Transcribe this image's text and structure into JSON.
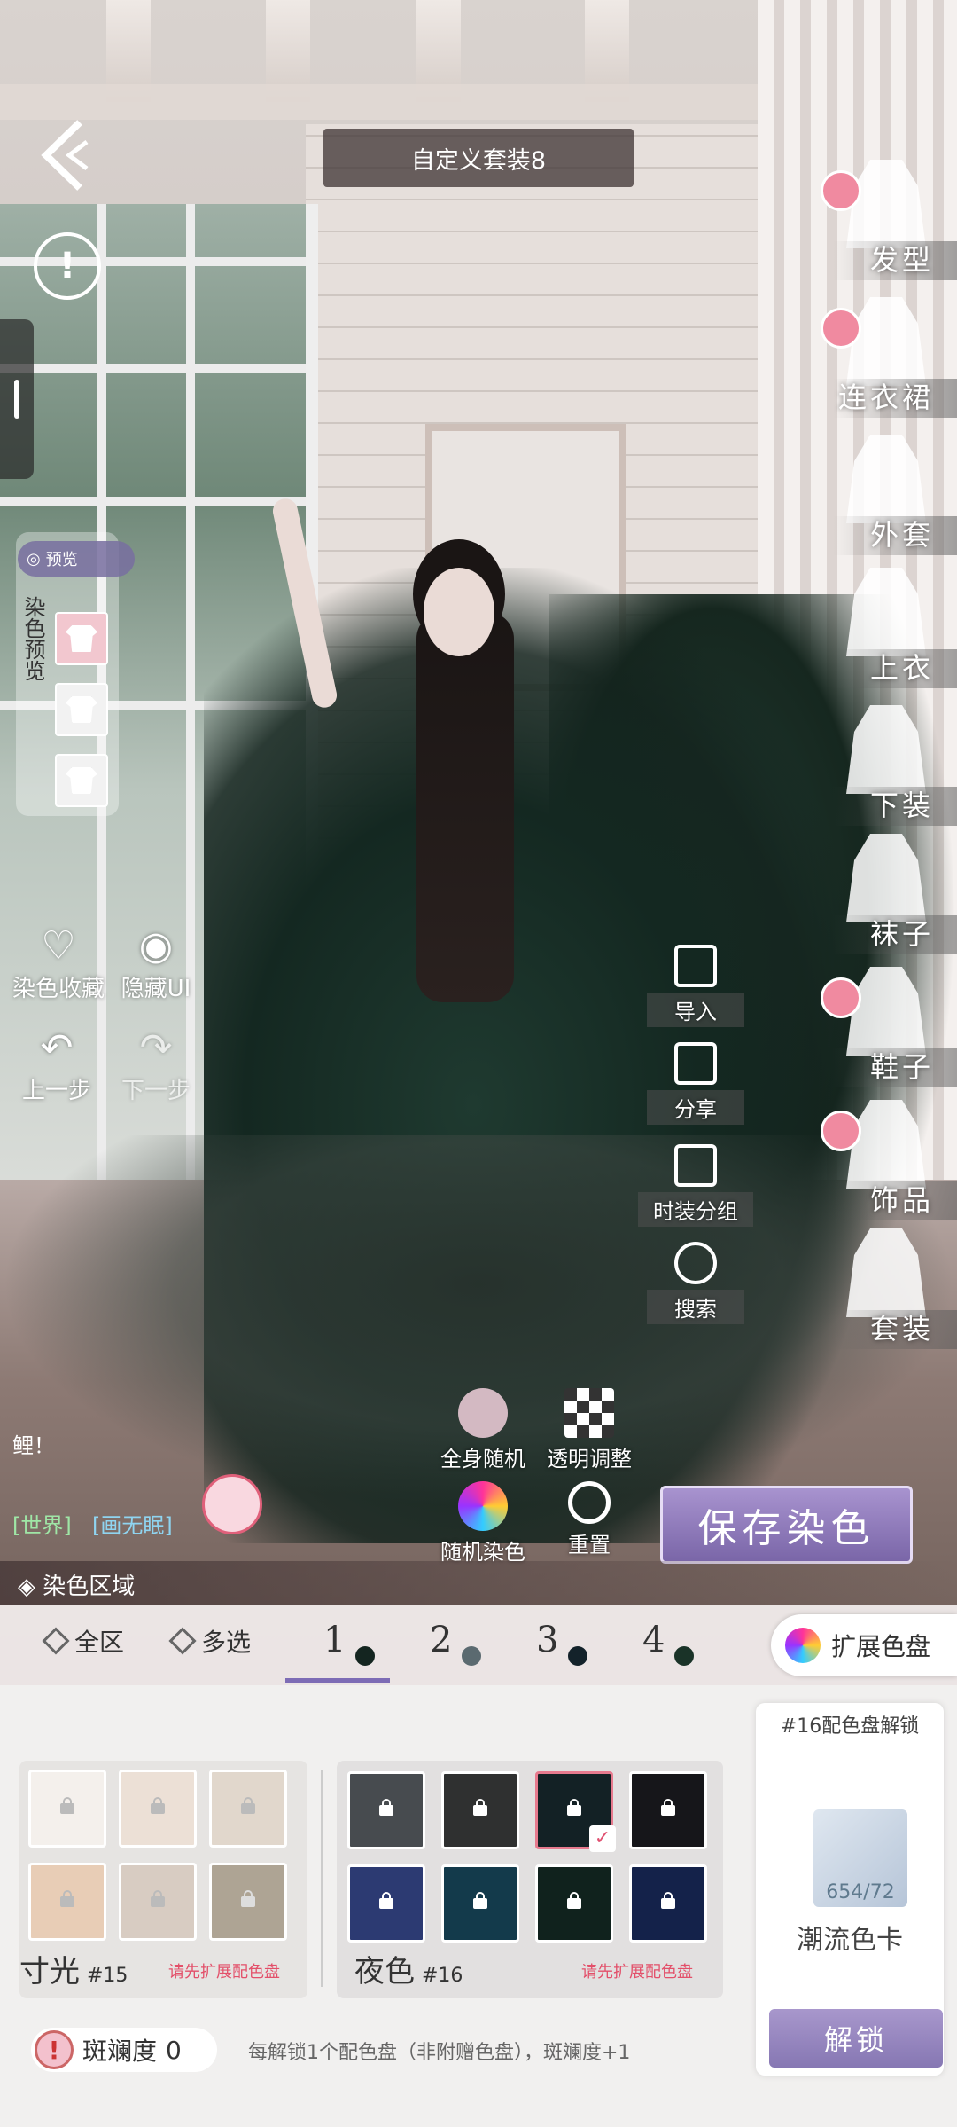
{
  "header": {
    "title": "自定义套装8",
    "back_icon": "back-arrow-icon",
    "info_icon": "exclamation-icon"
  },
  "dye_preview": {
    "preview_label": "预览",
    "side_label": "染色预览"
  },
  "left_tools": {
    "favorites": "染色收藏",
    "hide_ui": "隐藏UI",
    "undo": "上一步",
    "redo": "下一步"
  },
  "categories": [
    {
      "label": "发型",
      "pinned": true
    },
    {
      "label": "连衣裙",
      "pinned": true
    },
    {
      "label": "外套",
      "pinned": false
    },
    {
      "label": "上衣",
      "pinned": false
    },
    {
      "label": "下装",
      "pinned": false
    },
    {
      "label": "袜子",
      "pinned": false
    },
    {
      "label": "鞋子",
      "pinned": true
    },
    {
      "label": "饰品",
      "pinned": true
    },
    {
      "label": "套装",
      "pinned": false
    }
  ],
  "mid_buttons": {
    "import": "导入",
    "share": "分享",
    "outfit_group": "时装分组",
    "search": "搜索"
  },
  "tools": {
    "random_all": "全身随机",
    "transparency": "透明调整",
    "random_dye": "随机染色",
    "reset": "重置"
  },
  "chat": {
    "message": "鲤！",
    "channel": "[世界]",
    "user": "[画无眠]"
  },
  "save_button": "保存染色",
  "dye_area": {
    "label": "染色区域"
  },
  "tabs": {
    "all": "全区",
    "multi": "多选",
    "numbers": [
      {
        "n": "1",
        "color": "#142520"
      },
      {
        "n": "2",
        "color": "#5b6a70"
      },
      {
        "n": "3",
        "color": "#13222a"
      },
      {
        "n": "4",
        "color": "#1a3328"
      }
    ],
    "expand": "扩展色盘"
  },
  "palettes": [
    {
      "name": "寸光",
      "count": "#15",
      "note": "请先扩展配色盘",
      "colors": [
        "#f4f0ec",
        "#ece0d6",
        "#e1d7cc",
        "#e8cdb6",
        "#d8ccc2",
        "#aea494"
      ]
    },
    {
      "name": "夜色",
      "count": "#16",
      "note": "请先扩展配色盘",
      "colors": [
        "#474b4f",
        "#2f3030",
        "#132125",
        "#16161a",
        "#2c3a72",
        "#133a4b",
        "#10221d",
        "#14224a"
      ],
      "selected_index": 2
    }
  ],
  "unlock_card": {
    "title": "#16配色盘解锁",
    "item_name": "潮流色卡",
    "item_count": "654/72",
    "button": "解锁"
  },
  "mottle": {
    "label": "斑斓度",
    "value": "0",
    "hint": "每解锁1个配色盘（非附赠色盘），斑斓度+1"
  }
}
